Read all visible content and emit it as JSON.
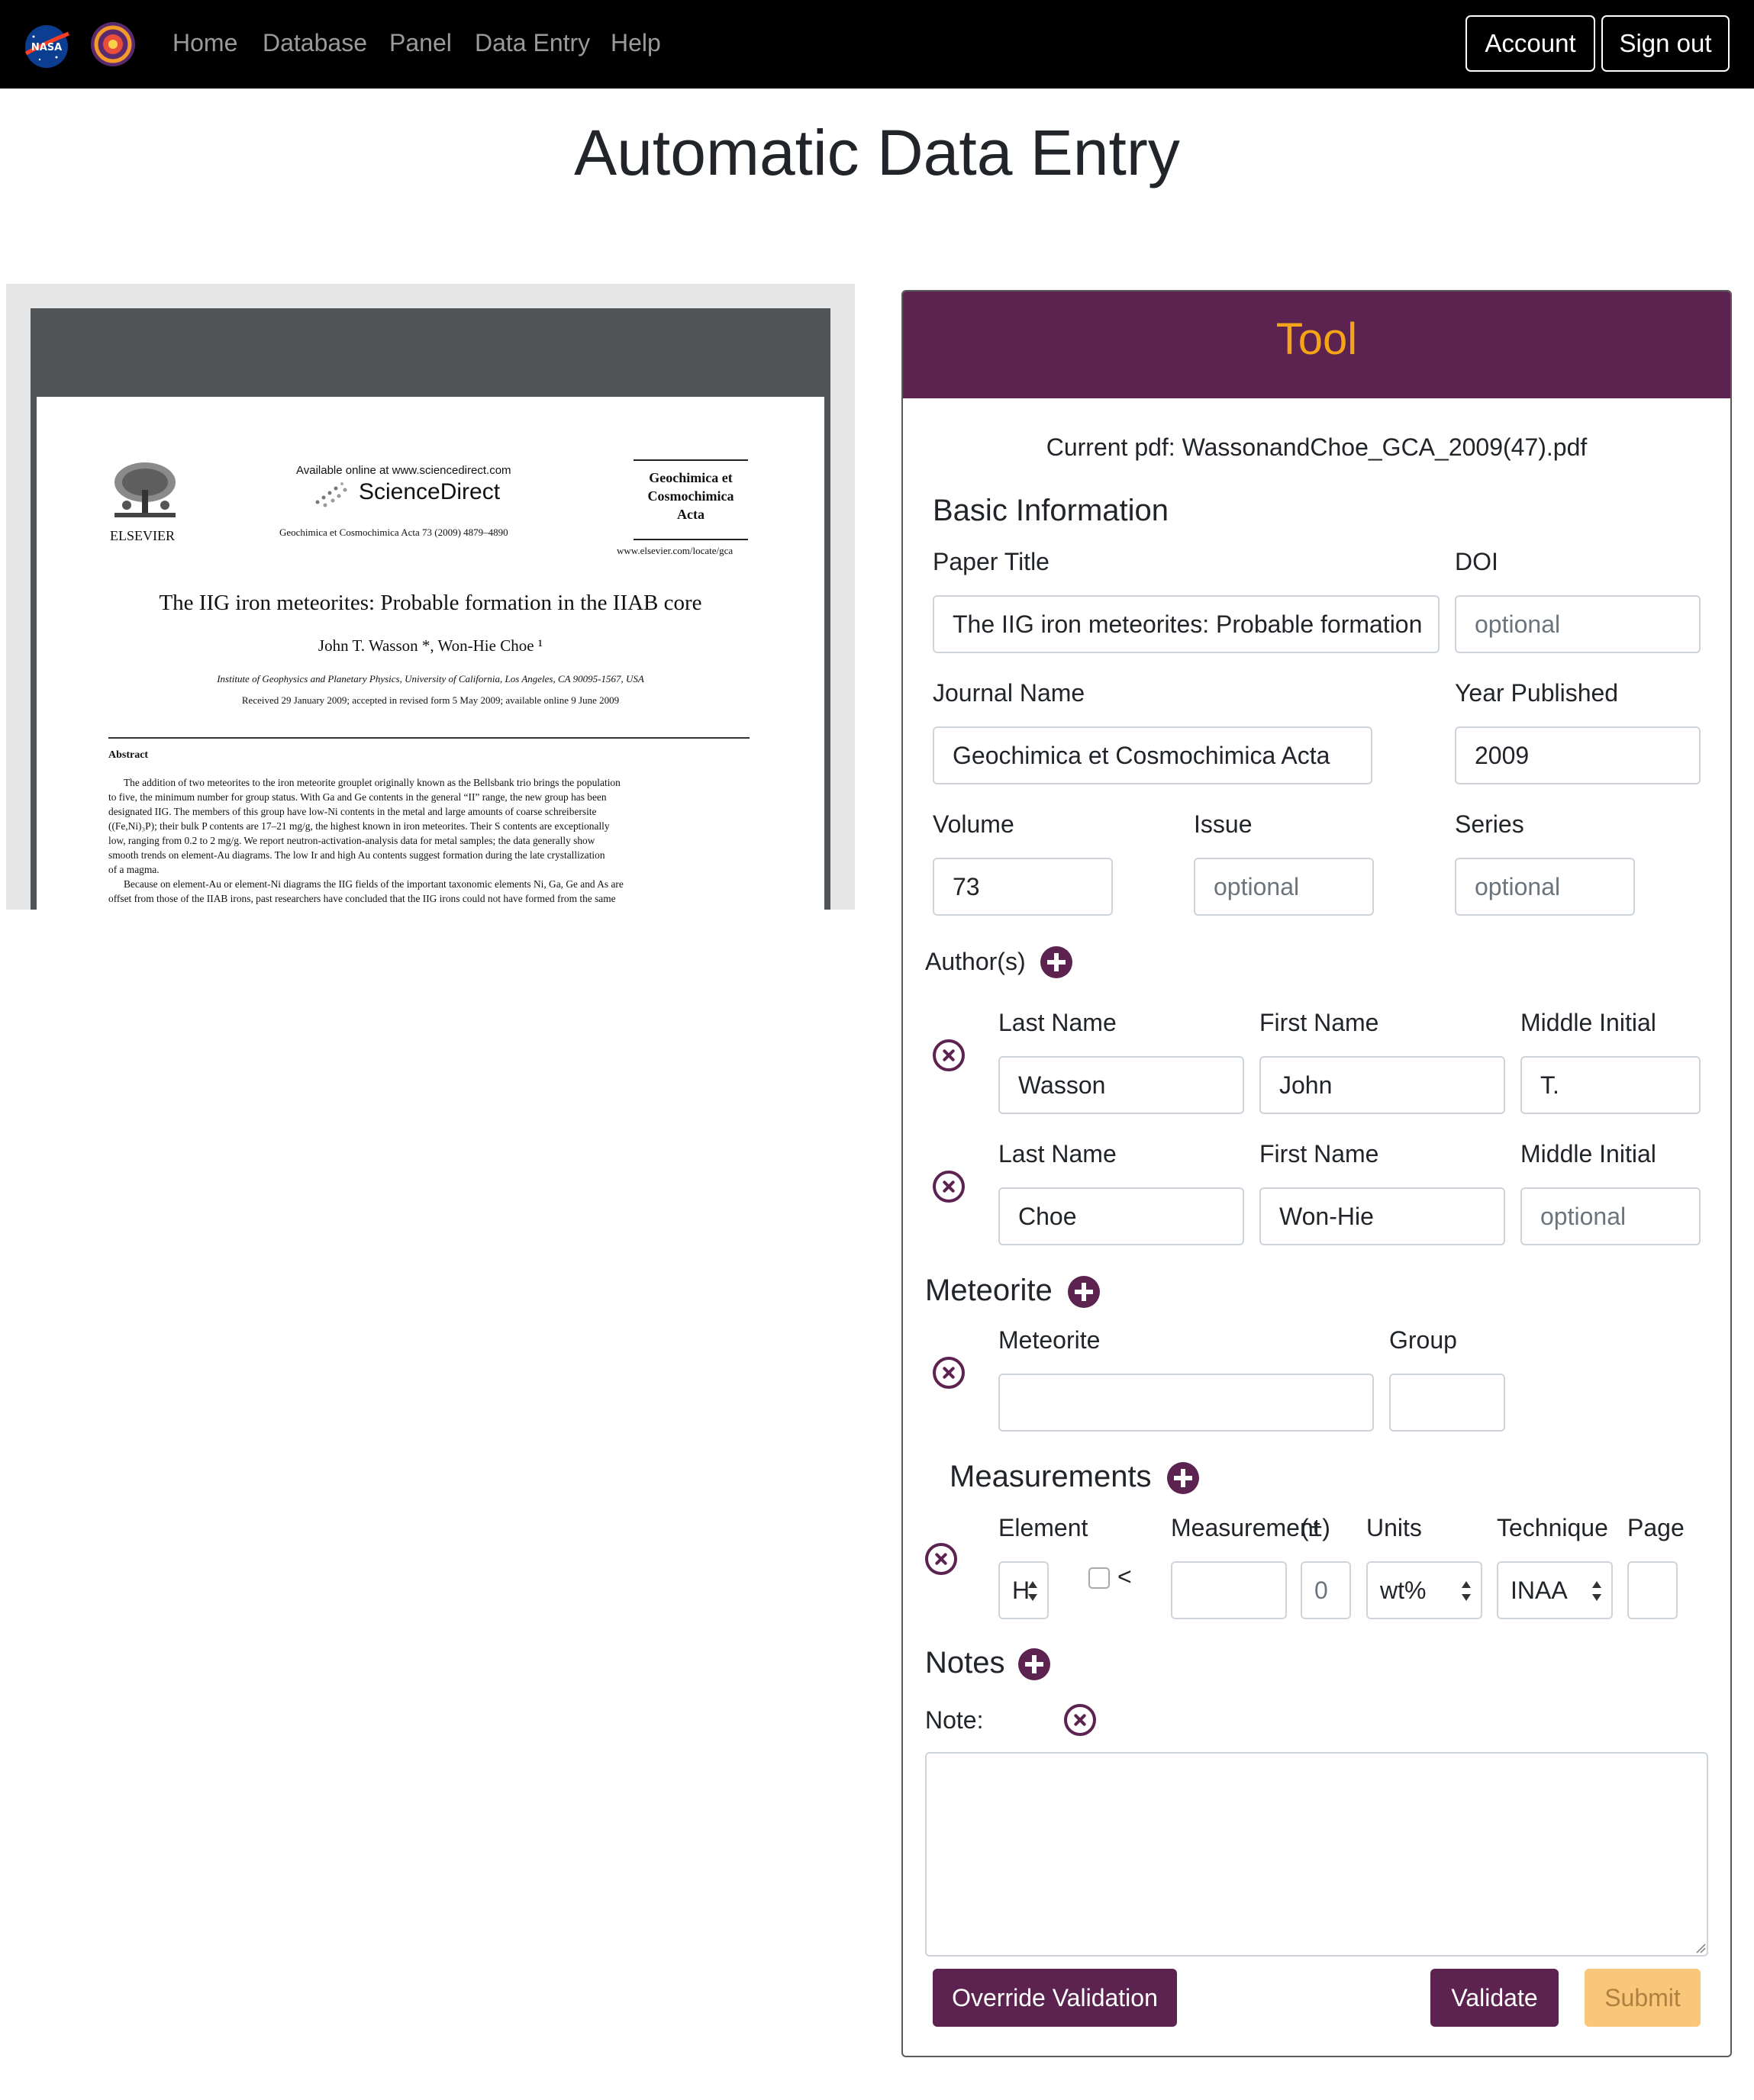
{
  "navbar": {
    "logos": [
      "nasa-logo",
      "meteorite-logo"
    ],
    "links": [
      "Home",
      "Database",
      "Panel",
      "Data Entry",
      "Help"
    ],
    "account_label": "Account",
    "signout_label": "Sign out"
  },
  "page_title": "Automatic Data Entry",
  "pdf": {
    "available_online": "Available online at www.sciencedirect.com",
    "sciencedirect": "ScienceDirect",
    "journal_ref": "Geochimica et Cosmochimica Acta 73 (2009) 4879–4890",
    "publisher": "ELSEVIER",
    "journal_line1": "Geochimica et",
    "journal_line2": "Cosmochimica",
    "journal_line3": "Acta",
    "journal_url": "www.elsevier.com/locate/gca",
    "title": "The IIG iron meteorites: Probable formation in the IIAB core",
    "authors": "John T. Wasson *, Won-Hie Choe ¹",
    "affiliation": "Institute of Geophysics and Planetary Physics, University of California, Los Angeles, CA 90095-1567, USA",
    "received": "Received 29 January 2009; accepted in revised form 5 May 2009; available online 9 June 2009",
    "abstract_heading": "Abstract",
    "abstract_lines": [
      "The addition of two meteorites to the iron meteorite grouplet originally known as the Bellsbank trio brings the population",
      "to five, the minimum number for group status. With Ga and Ge contents in the general “II” range, the new group has been",
      "designated IIG. The members of this group have low-Ni contents in the metal and large amounts of coarse schreibersite",
      "((Fe,Ni)₃P); their bulk P contents are 17–21 mg/g, the highest known in iron meteorites. Their S contents are exceptionally",
      "low, ranging from 0.2 to 2 mg/g. We report neutron-activation-analysis data for metal samples; the data generally show",
      "smooth trends on element-Au diagrams. The low Ir and high Au contents suggest formation during the late crystallization",
      "of a magma.",
      "Because on element-Au or element-Ni diagrams the IIG fields of the important taxonomic elements Ni, Ga, Ge and As are",
      "offset from those of the IIAB irons, past researchers have concluded that the IIG irons could not have formed from the same"
    ]
  },
  "tool": {
    "title": "Tool",
    "current_pdf": "Current pdf: WassonandChoe_GCA_2009(47).pdf",
    "basic_info_heading": "Basic Information",
    "paper_title_label": "Paper Title",
    "paper_title_value": "The IIG iron meteorites: Probable formation",
    "doi_label": "DOI",
    "doi_placeholder": "optional",
    "journal_label": "Journal Name",
    "journal_value": "Geochimica et Cosmochimica Acta",
    "year_label": "Year Published",
    "year_value": "2009",
    "volume_label": "Volume",
    "volume_value": "73",
    "issue_label": "Issue",
    "issue_placeholder": "optional",
    "series_label": "Series",
    "series_placeholder": "optional",
    "authors_heading": "Author(s)",
    "authors": [
      {
        "last_label": "Last Name",
        "first_label": "First Name",
        "middle_label": "Middle Initial",
        "last": "Wasson",
        "first": "John",
        "middle": "T.",
        "middle_placeholder": ""
      },
      {
        "last_label": "Last Name",
        "first_label": "First Name",
        "middle_label": "Middle Initial",
        "last": "Choe",
        "first": "Won-Hie",
        "middle": "",
        "middle_placeholder": "optional"
      }
    ],
    "meteorite_heading": "Meteorite",
    "meteorite_label": "Meteorite",
    "group_label": "Group",
    "meteorite_value": "",
    "group_value": "",
    "measurements_heading": "Measurements",
    "measurement_headers": {
      "element": "Element",
      "measurement": "Measurement",
      "plusminus": "(±)",
      "units": "Units",
      "technique": "Technique",
      "page": "Page"
    },
    "measurement_row": {
      "element": "H",
      "less_than_label": "<",
      "less_than_checked": false,
      "measurement": "",
      "plusminus": "0",
      "units": "wt%",
      "technique": "INAA",
      "page": ""
    },
    "notes_heading": "Notes",
    "note_label": "Note:",
    "note_value": "",
    "buttons": {
      "override": "Override Validation",
      "validate": "Validate",
      "submit": "Submit"
    },
    "colors": {
      "primary": "#5c2351",
      "accent": "#f5a418",
      "submit_disabled": "#f9c77a"
    }
  }
}
